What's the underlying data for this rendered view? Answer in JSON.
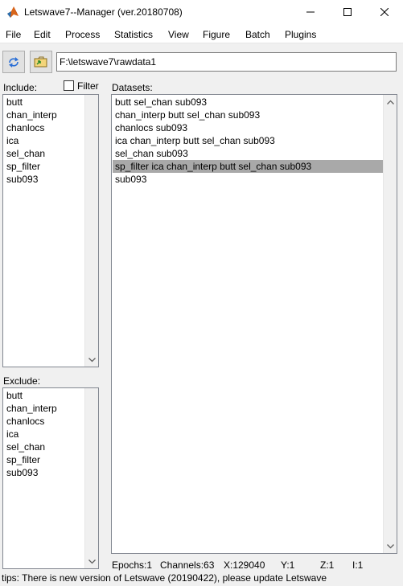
{
  "window": {
    "title": "Letswave7--Manager (ver.20180708)",
    "icons": {
      "app": "matlab-icon",
      "minimize": "minimize-icon",
      "maximize": "maximize-icon",
      "close": "close-icon"
    }
  },
  "menu": [
    "File",
    "Edit",
    "Process",
    "Statistics",
    "View",
    "Figure",
    "Batch",
    "Plugins"
  ],
  "toolbar": {
    "refresh_icon": "refresh-arrows-icon",
    "folder_icon": "open-folder-icon",
    "path": "F:\\letswave7\\rawdata1"
  },
  "include": {
    "label": "Include:",
    "filter_label": "Filter",
    "filter_checked": false,
    "items": [
      "butt",
      "chan_interp",
      "chanlocs",
      "ica",
      "sel_chan",
      "sp_filter",
      "sub093"
    ]
  },
  "exclude": {
    "label": "Exclude:",
    "items": [
      "butt",
      "chan_interp",
      "chanlocs",
      "ica",
      "sel_chan",
      "sp_filter",
      "sub093"
    ]
  },
  "datasets": {
    "label": "Datasets:",
    "items": [
      "butt sel_chan sub093",
      "chan_interp butt sel_chan sub093",
      "chanlocs sub093",
      "ica chan_interp butt sel_chan sub093",
      "sel_chan sub093",
      "sp_filter ica chan_interp butt sel_chan sub093",
      "sub093"
    ],
    "selected_index": 5
  },
  "info": {
    "epochs": "Epochs:1",
    "channels": "Channels:63",
    "x": "X:129040",
    "y": "Y:1",
    "z": "Z:1",
    "i": "I:1"
  },
  "tips": "tips: There is new version of Letswave (20190422), please update Letswave",
  "colors": {
    "selected_row": "#a9a9a9",
    "window_bg": "#f0f0f0"
  }
}
